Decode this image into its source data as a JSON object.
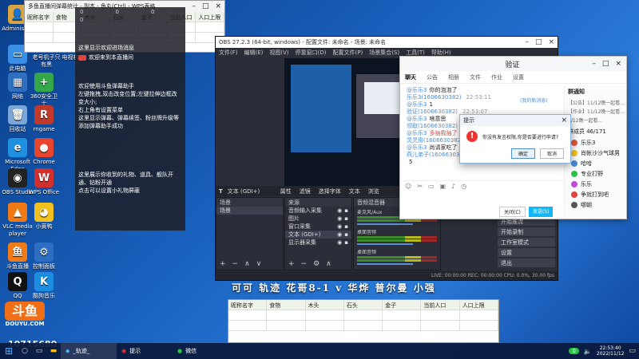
{
  "desktop": {
    "icons": [
      {
        "label": "Administr...",
        "glyph": "👤",
        "color": "#d9a441"
      },
      {
        "label": "此电脑",
        "glyph": "▭",
        "color": "#3a8ee6"
      },
      {
        "label": "网络",
        "glyph": "▦",
        "color": "#2e6fbf"
      },
      {
        "label": "回收站",
        "glyph": "🗑",
        "color": "#7aa7d8"
      },
      {
        "label": "Microsoft Edge",
        "glyph": "e",
        "color": "#1f8fe0"
      },
      {
        "label": "OBS Studio",
        "glyph": "◉",
        "color": "#222"
      },
      {
        "label": "VLC media player",
        "glyph": "▲",
        "color": "#f07a16"
      },
      {
        "label": "斗鱼直播",
        "glyph": "鱼",
        "color": "#f07a16"
      },
      {
        "label": "QQ",
        "glyph": "Q",
        "color": "#111"
      },
      {
        "label": "360安全卫士",
        "glyph": "+",
        "color": "#33a74a"
      },
      {
        "label": "rngame",
        "glyph": "R",
        "color": "#c0392b"
      },
      {
        "label": "Chrome",
        "glyph": "●",
        "color": "#e8452f"
      },
      {
        "label": "WPS Office",
        "glyph": "W",
        "color": "#d22f2f"
      },
      {
        "label": "小黄鸭",
        "glyph": "◕",
        "color": "#f3c11f"
      },
      {
        "label": "控制面板",
        "glyph": "⚙",
        "color": "#2d6ec2"
      },
      {
        "label": "酷狗音乐",
        "glyph": "K",
        "color": "#1d8de0"
      }
    ],
    "douyu": {
      "logo": "斗鱼",
      "sub": "DOUYU.COM",
      "room": "10715680"
    },
    "taskbar_top_items": [
      "老号机子只有黑",
      "电视机",
      "王者"
    ]
  },
  "sheet_top": {
    "title": "多鱼直播间弹幕统计 - 副本 - 鱼丸(Ctrl) - WPS表格",
    "headers": [
      "昵称名字",
      "食物",
      "木头",
      "石头",
      "金子",
      "当前人口",
      "人口上限"
    ]
  },
  "sheet_bottom": {
    "headers": [
      "昵称名字",
      "食物",
      "木头",
      "石头",
      "金子",
      "当前人口",
      "人口上限"
    ]
  },
  "overlay": {
    "stats": [
      "0",
      "0",
      "0",
      "0"
    ],
    "welcome_line": "这里显示欢迎进场消息",
    "welcome_user": "欢迎来到本直播间",
    "para1": [
      "欢迎使用斗鱼弹幕助手",
      "左键拖拽,双击改变位置;左键拉伸边框改变大小;",
      "右上角有设置菜单",
      "这里显示弹幕、弹幕续签、粉丝牌升级等",
      "添加弹幕助手成功"
    ],
    "para2": [
      "这里展示你收到的礼物、道具、舰队开通、钻粉开通",
      "点击可以设置小礼物屏蔽"
    ]
  },
  "obs": {
    "title": "OBS 27.2.3 (64-bit, windows) - 配置文件: 未命名 - 场景: 未命名",
    "menu": [
      "文件(F)",
      "编辑(E)",
      "视图(V)",
      "停靠窗口(D)",
      "配置文件(P)",
      "场景集合(S)",
      "工具(T)",
      "帮助(H)"
    ],
    "source_bar": "文本 (GDI+)",
    "toolbar": [
      "属性",
      "滤镜",
      "选择字体",
      "文本",
      "浏览"
    ],
    "scenes_head": "场景",
    "scene_item": "场景",
    "sources_head": "来源",
    "sources": [
      "音频输入采集",
      "图片",
      "窗口采集",
      "文本 (GDI+)",
      "显示器采集"
    ],
    "mixer_head": "音频混音器",
    "mixer_channels": [
      "麦克风/Aux",
      "桌面音频",
      "桌面音频"
    ],
    "status": "LIVE: 00:00:00  REC: 00:00:00  CPU: 0.0%, 30.00 fps"
  },
  "obs_right": {
    "buttons": [
      "开始推流",
      "开始录制",
      "工作室模式",
      "设置",
      "退出"
    ]
  },
  "scroll_text": "可可 轨迹 花哥8-1 v 华烨 普尔曼 小强",
  "qq": {
    "group": "验证",
    "tabs": [
      "聊天",
      "公告",
      "相册",
      "文件",
      "作业",
      "设置"
    ],
    "messages": [
      {
        "name": "@乐乐3",
        "text": "你的泡泡了",
        "time": ""
      },
      {
        "name": "乐乐3(1606630382)",
        "text": "",
        "time": "22:53:11"
      },
      {
        "name": "@乐乐3",
        "text": "1",
        "time": ""
      },
      {
        "name": "验证(1606630382)",
        "text": "",
        "time": "22:53:07"
      },
      {
        "name": "@乐乐3",
        "text": "啥意思",
        "time": ""
      },
      {
        "name": "领取(1606630382)",
        "text": "",
        "time": "22:53:20"
      },
      {
        "name": "@乐乐3",
        "text": "多抽我抽了",
        "time": ""
      },
      {
        "name": "灵灵用(1606630382)",
        "text": "",
        "time": "22:53:29"
      },
      {
        "name": "@乐乐3",
        "text": "尚请家吃了",
        "time": ""
      },
      {
        "name": "燕儿弟子(1606630382)",
        "text": "",
        "time": "22:53:49"
      },
      {
        "name": "",
        "text": "5",
        "time": ""
      }
    ],
    "notice": "群通知",
    "notice_lines": [
      "【公告】11/12晚一起看...",
      "【作业】11/12晚一起看...",
      "1/12晚一起看..."
    ],
    "members_label": "群成员 46/171",
    "members": [
      "乐乐3",
      "肖帐沙沙气球男",
      "哈哈",
      "专业打野",
      "乐乐",
      "争就打到吧",
      "哪朝"
    ],
    "send_close": "关闭(C)",
    "send_button": "发送(S)",
    "side_tag": "(我的新消息)"
  },
  "dialog": {
    "title": "提示",
    "message": "你没有发言权限,你是否要进行申请?",
    "ok": "确定",
    "cancel": "取消"
  },
  "taskbar": {
    "items": [
      "_轨迹_",
      "提示",
      "微信"
    ],
    "time": "22:53:40",
    "date": "2022/11/12",
    "badge": "0"
  }
}
